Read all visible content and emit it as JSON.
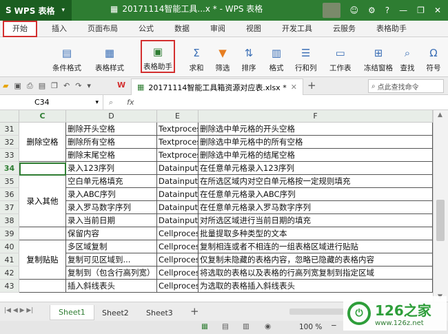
{
  "app": {
    "name": "WPS 表格",
    "doc_title": "20171114智能工具...x * - WPS 表格"
  },
  "ribbon_tabs": [
    "开始",
    "插入",
    "页面布局",
    "公式",
    "数据",
    "审阅",
    "视图",
    "开发工具",
    "云服务",
    "表格助手"
  ],
  "ribbon_buttons": [
    "条件格式",
    "表格样式",
    "表格助手",
    "求和",
    "筛选",
    "排序",
    "格式",
    "行和列",
    "工作表",
    "冻结窗格",
    "查找",
    "符号"
  ],
  "file_tab": "20171114智能工具箱资源对应表.xlsx *",
  "search_placeholder": "点此查找命令",
  "name_box": "C34",
  "fx_label": "fx",
  "columns": [
    "C",
    "D",
    "E",
    "F"
  ],
  "rows": [
    {
      "num": "31",
      "d": "删除开头空格",
      "e": "Textprocess",
      "f": "删除选中单元格的开头空格"
    },
    {
      "num": "32",
      "d": "删除所有空格",
      "e": "Textprocess",
      "f": "删除选中单元格中的所有空格"
    },
    {
      "num": "33",
      "d": "删除末尾空格",
      "e": "Textprocess",
      "f": "删除选中单元格的结尾空格"
    },
    {
      "num": "34",
      "d": "录入123序列",
      "e": "Datainput",
      "f": "在任意单元格录入123序列"
    },
    {
      "num": "35",
      "d": "空白单元格填充",
      "e": "Datainput",
      "f": "在所选区域内对空白单元格按一定规则填充"
    },
    {
      "num": "36",
      "d": "录入ABC序列",
      "e": "Datainput",
      "f": "在任意单元格录入ABC序列"
    },
    {
      "num": "37",
      "d": "录入罗马数字序列",
      "e": "Datainput",
      "f": "在任意单元格录入罗马数字序列"
    },
    {
      "num": "38",
      "d": "录入当前日期",
      "e": "Datainput",
      "f": "对所选区域进行当前日期的填充"
    },
    {
      "num": "39",
      "d": "保留内容",
      "e": "Cellprocess",
      "f": "批量提取多种类型的文本"
    },
    {
      "num": "40",
      "d": "多区域复制",
      "e": "Cellprocess",
      "f": "复制相连或者不相连的一组表格区域进行贴贴"
    },
    {
      "num": "41",
      "d": "复制可见区域到...",
      "e": "Cellprocess",
      "f": "仅复制未隐藏的表格内容，忽略已隐藏的表格内容"
    },
    {
      "num": "42",
      "d": "复制到（包含行高列宽）",
      "e": "Cellprocess",
      "f": "将选取的表格以及表格的行高列宽复制到指定区域"
    },
    {
      "num": "43",
      "d": "插入斜线表头",
      "e": "Cellprocess",
      "f": "为选取的表格插入斜线表头"
    }
  ],
  "merged_labels": {
    "group1": "删除空格",
    "group2": "录入其他",
    "group3": "复制贴贴"
  },
  "sheets": [
    "Sheet1",
    "Sheet2",
    "Sheet3"
  ],
  "zoom": "100 %",
  "watermark": {
    "brand": "126之家",
    "url": "www.126z.net"
  }
}
